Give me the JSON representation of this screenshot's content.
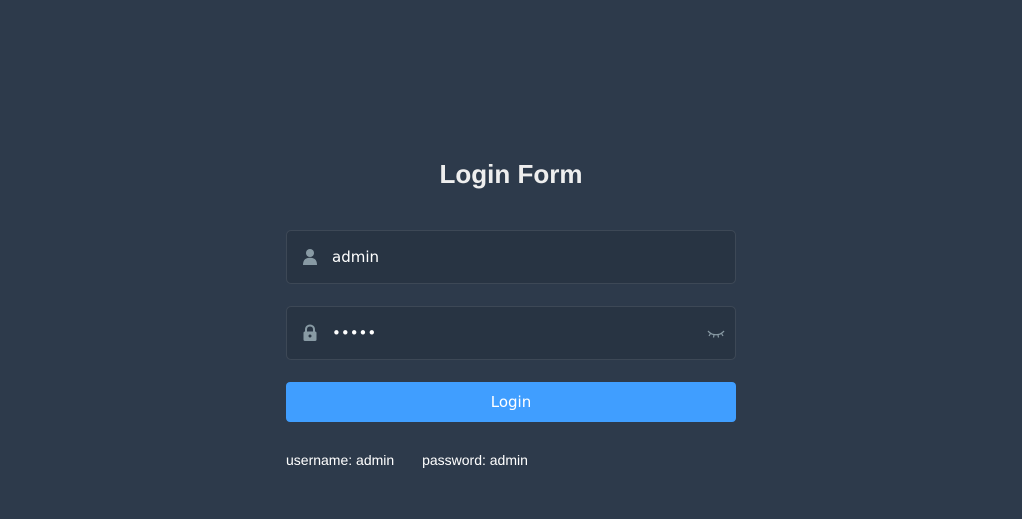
{
  "form": {
    "title": "Login Form",
    "username": {
      "value": "admin",
      "icon": "user-icon"
    },
    "password": {
      "value": "admin",
      "icon": "lock-icon",
      "visibility_icon": "eye-closed-icon"
    },
    "login_label": "Login",
    "tips": {
      "username": "username: admin",
      "password": "password: admin"
    }
  },
  "colors": {
    "background": "#2d3a4b",
    "input_background": "#283443",
    "primary": "#409eff",
    "title": "#eeeeee",
    "icon": "#889aa4"
  }
}
